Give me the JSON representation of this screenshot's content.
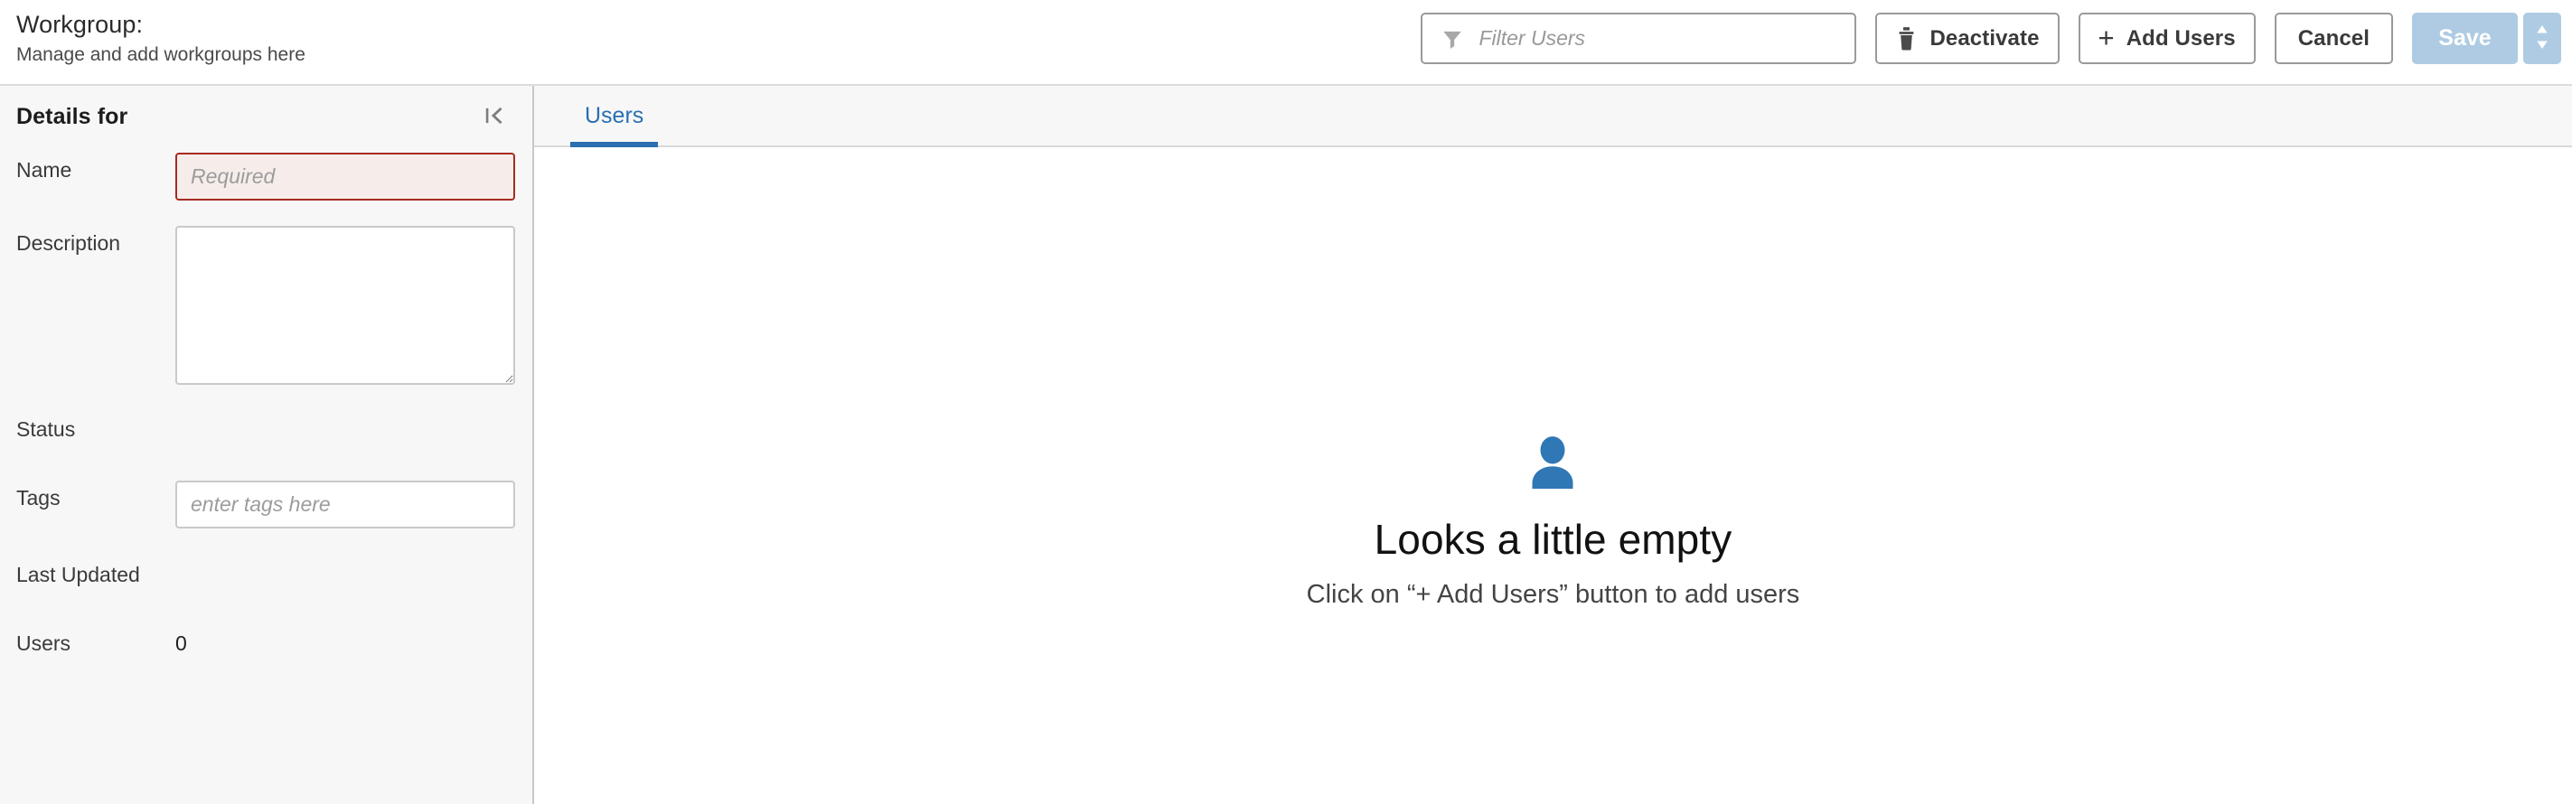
{
  "header": {
    "title": "Workgroup:",
    "subtitle": "Manage and add workgroups here",
    "filter": {
      "placeholder": "Filter Users",
      "value": "",
      "icon": "filter-funnel-icon"
    },
    "buttons": {
      "deactivate": {
        "label": "Deactivate",
        "icon": "trash-icon"
      },
      "add_users": {
        "label": "Add Users",
        "icon": "plus-icon"
      },
      "cancel": {
        "label": "Cancel"
      },
      "save": {
        "label": "Save",
        "disabled": true,
        "dropdown_icon": "caret-up-down-icon"
      }
    }
  },
  "sidebar": {
    "title": "Details for",
    "collapse_icon": "collapse-panel-left-icon",
    "fields": [
      {
        "label": "Name",
        "type": "input",
        "value": "",
        "placeholder": "Required",
        "required": true
      },
      {
        "label": "Description",
        "type": "textarea",
        "value": "",
        "placeholder": ""
      },
      {
        "label": "Status",
        "type": "text",
        "value": ""
      },
      {
        "label": "Tags",
        "type": "input",
        "value": "",
        "placeholder": "enter tags here"
      },
      {
        "label": "Last Updated",
        "type": "text",
        "value": ""
      },
      {
        "label": "Users",
        "type": "text",
        "value": "0"
      }
    ]
  },
  "main": {
    "tabs": [
      {
        "label": "Users",
        "active": true
      }
    ],
    "empty_state": {
      "icon": "person-icon",
      "title": "Looks a little empty",
      "subtitle": "Click on “+ Add Users” button to add users"
    }
  },
  "colors": {
    "accent_blue": "#2a6fb0",
    "save_disabled": "#aecbe3",
    "required_border": "#a62b21",
    "required_bg": "#f6edeb",
    "sidebar_bg": "#f7f7f7"
  }
}
